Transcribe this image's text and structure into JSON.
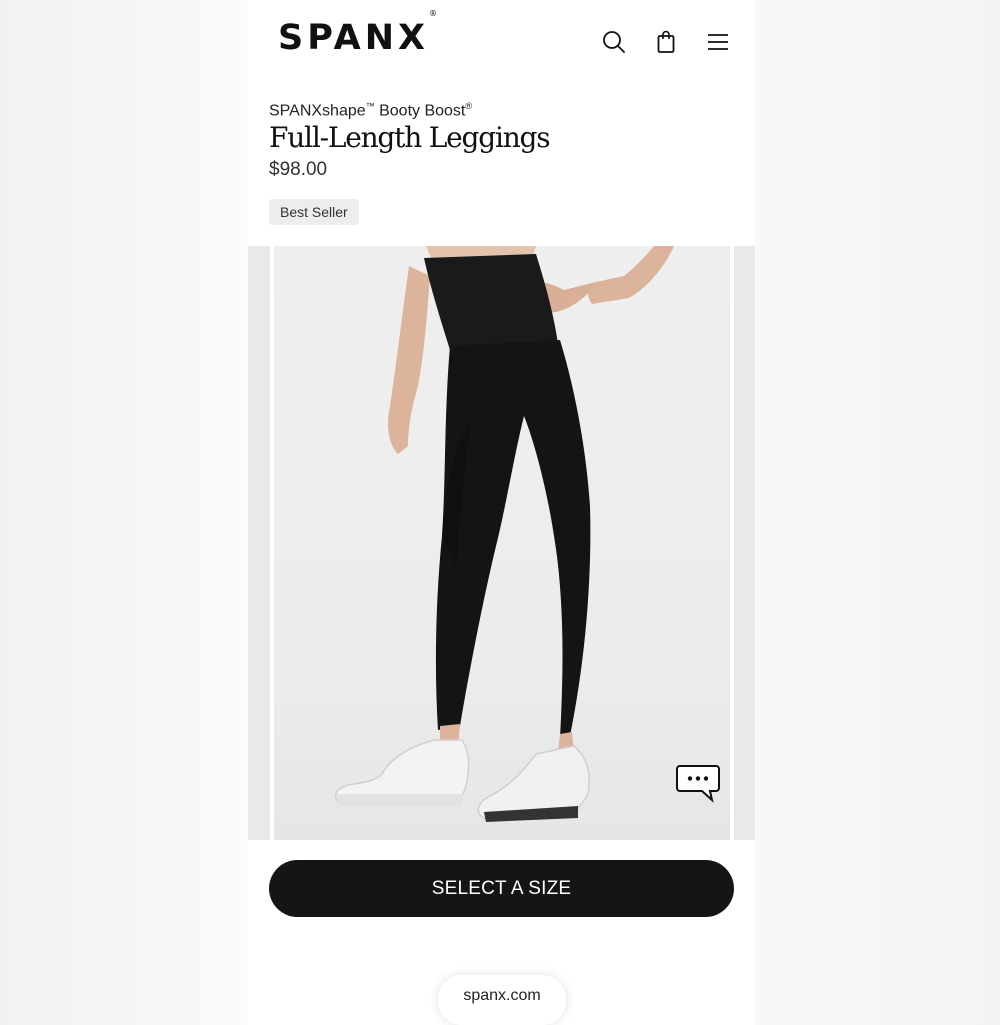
{
  "header": {
    "logo_text": "SPANX",
    "logo_mark": "®",
    "icons": [
      "search-icon",
      "shopping-bag-icon",
      "menu-icon"
    ]
  },
  "product": {
    "subtitle_main": "SPANXshape",
    "subtitle_tm": "™",
    "subtitle_rest": " Booty Boost",
    "subtitle_reg": "®",
    "title": "Full-Length Leggings",
    "price": "$98.00",
    "badge": "Best Seller"
  },
  "gallery": {
    "image": "product-photo-black-leggings-white-sneakers",
    "chat_icon": "chat-bubble-icon"
  },
  "cta": {
    "select_size_label": "SELECT A SIZE"
  },
  "browser": {
    "url": "spanx.com"
  },
  "colors": {
    "button_bg": "#151515",
    "badge_bg": "#ededed",
    "leggings": "#141414"
  }
}
